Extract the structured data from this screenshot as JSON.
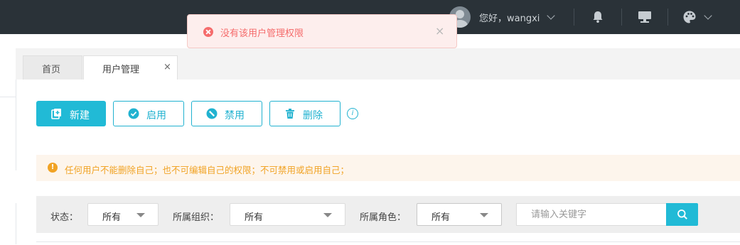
{
  "header": {
    "greeting": "您好，wangxi",
    "icons": [
      "avatar",
      "chevron-down-icon",
      "bell-icon",
      "monitor-icon",
      "palette-icon",
      "chevron-down-icon"
    ]
  },
  "toast": {
    "type": "error",
    "message": "没有该用户管理权限",
    "close": "×",
    "color": "#f56c6c"
  },
  "tabs": [
    {
      "label": "首页",
      "active": false
    },
    {
      "label": "用户管理",
      "active": true,
      "close": "×"
    }
  ],
  "toolbar": {
    "new_label": "新建",
    "enable_label": "启用",
    "disable_label": "禁用",
    "delete_label": "删除",
    "info_symbol": "i",
    "accent": "#21bad6"
  },
  "notice": {
    "symbol": "!",
    "text": "任何用户不能删除自己；也不可编辑自己的权限；不可禁用或启用自己；",
    "color": "#f1a325"
  },
  "filters": {
    "status_label": "状态：",
    "status_value": "所有",
    "org_label": "所属组织：",
    "org_value": "所有",
    "role_label": "所属角色：",
    "role_value": "所有",
    "search_placeholder": "请输入关键字"
  }
}
